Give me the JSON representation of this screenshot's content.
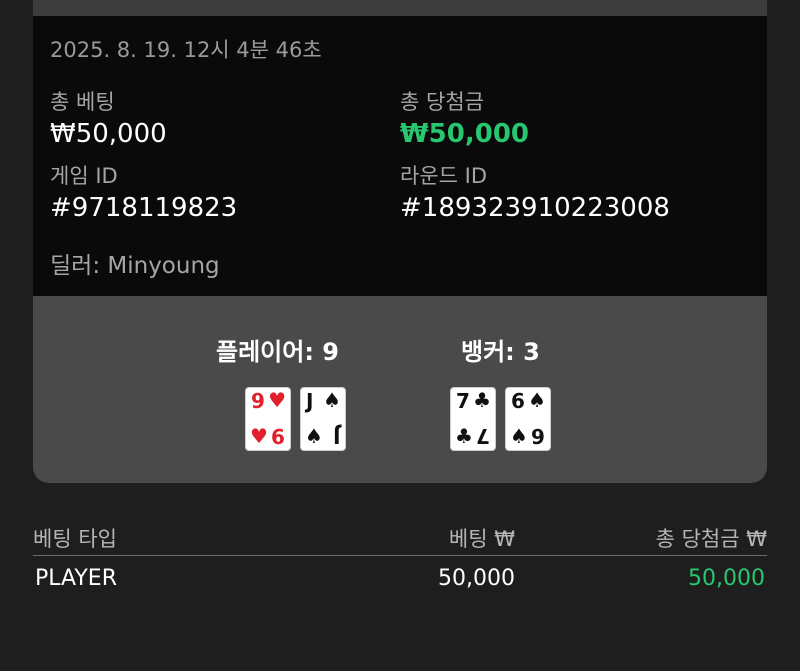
{
  "round": {
    "timestamp": "2025. 8. 19. 12시 4분 46초",
    "total_bet_label": "총 베팅",
    "total_bet_value": "₩50,000",
    "total_win_label": "총 당첨금",
    "total_win_value": "₩50,000",
    "game_id_label": "게임 ID",
    "game_id_value": "#9718119823",
    "round_id_label": "라운드 ID",
    "round_id_value": "#189323910223008",
    "dealer": "딜러: Minyoung"
  },
  "hands": {
    "player_title": "플레이어: 9",
    "banker_title": "뱅커: 3",
    "player_cards": [
      {
        "rank": "9",
        "suit": "♥",
        "color": "#e0202a"
      },
      {
        "rank": "J",
        "suit": "♠",
        "color": "#111111"
      }
    ],
    "banker_cards": [
      {
        "rank": "7",
        "suit": "♣",
        "color": "#111111"
      },
      {
        "rank": "6",
        "suit": "♠",
        "color": "#111111"
      }
    ]
  },
  "bets_table": {
    "headers": [
      "베팅 타입",
      "베팅 ₩",
      "총 당첨금 ₩"
    ],
    "rows": [
      {
        "type": "PLAYER",
        "bet": "50,000",
        "win": "50,000"
      }
    ]
  },
  "colors": {
    "win_green": "#28c76f",
    "panel_dark": "#0a0a0a",
    "card_area": "#4a4a4a",
    "page_bg": "#1e1e1e"
  }
}
